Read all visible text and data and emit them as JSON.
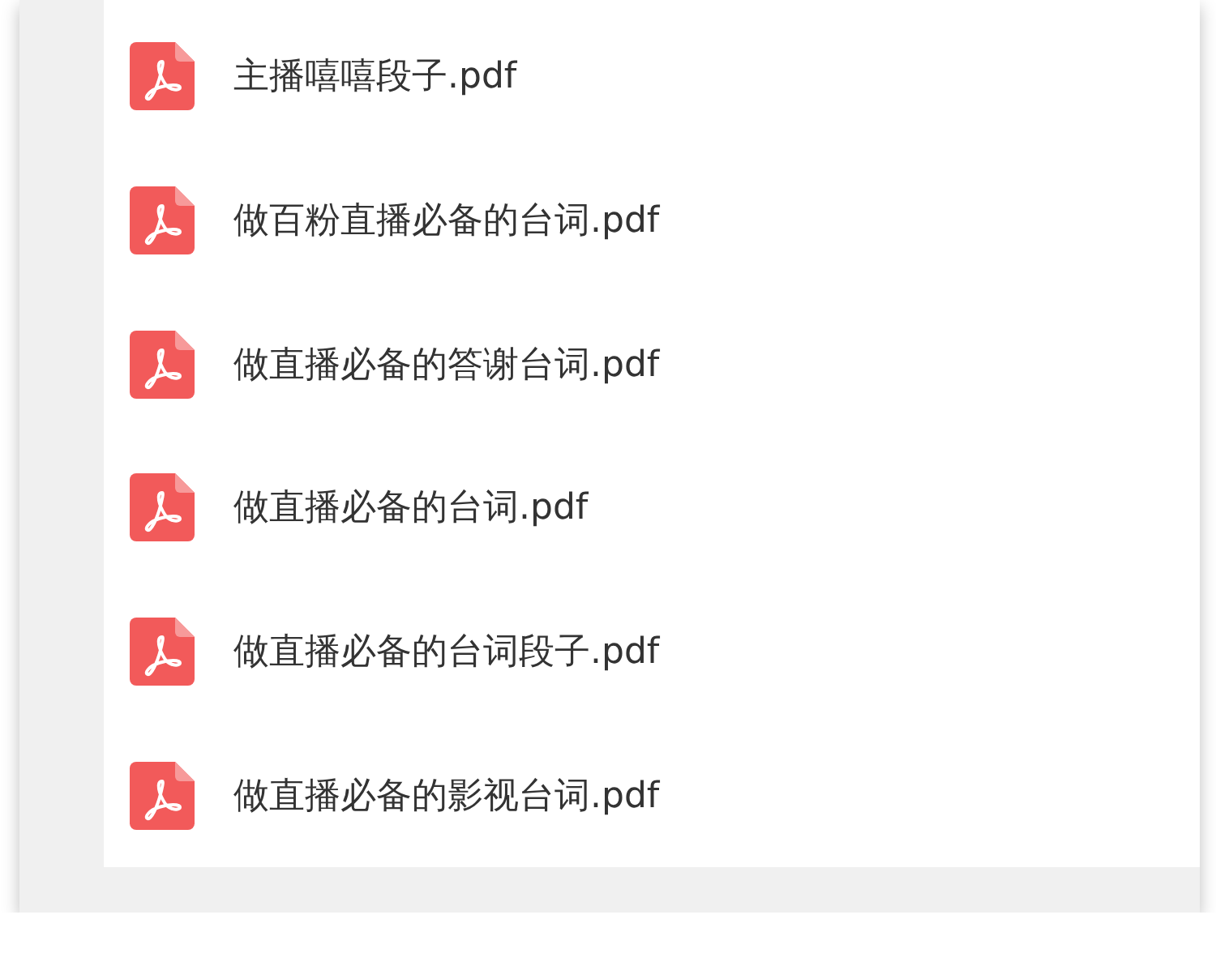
{
  "files": [
    {
      "name": "主播嘻嘻段子.pdf"
    },
    {
      "name": "做百粉直播必备的台词.pdf"
    },
    {
      "name": "做直播必备的答谢台词.pdf"
    },
    {
      "name": "做直播必备的台词.pdf"
    },
    {
      "name": "做直播必备的台词段子.pdf"
    },
    {
      "name": "做直播必备的影视台词.pdf"
    }
  ]
}
